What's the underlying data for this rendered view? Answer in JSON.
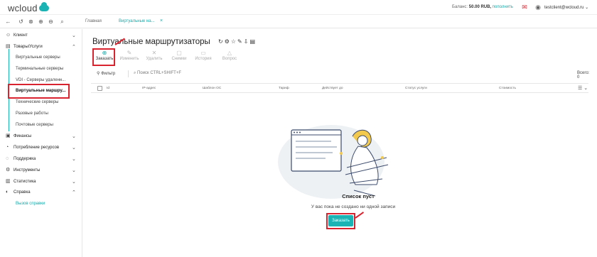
{
  "header": {
    "logo_text": "wcloud",
    "balance_label": "Баланс:",
    "balance_value": "50.00 RUB,",
    "topup_link": "пополнить",
    "user_email": "testclient@wcloud.ru"
  },
  "toolbar": {
    "tabs": [
      {
        "label": "Главная"
      },
      {
        "label": "Виртуальные на..."
      }
    ]
  },
  "sidebar": {
    "items": [
      {
        "label": "Клиент",
        "icon": "person-icon",
        "chevron": "⌄"
      },
      {
        "label": "Товары/Услуги",
        "icon": "cart-icon",
        "chevron": "⌃"
      },
      {
        "label": "Финансы",
        "icon": "wallet-icon",
        "chevron": "⌄"
      },
      {
        "label": "Потребление ресурсов",
        "icon": "gauge-icon",
        "chevron": "⌄"
      },
      {
        "label": "Поддержка",
        "icon": "chat-icon",
        "chevron": "⌄"
      },
      {
        "label": "Инструменты",
        "icon": "gear-icon",
        "chevron": "⌄"
      },
      {
        "label": "Статистика",
        "icon": "chart-icon",
        "chevron": "⌄"
      },
      {
        "label": "Справка",
        "icon": "help-icon",
        "chevron": "⌃"
      }
    ],
    "sub_items": [
      {
        "label": "Виртуальные серверы"
      },
      {
        "label": "Терминальные серверы"
      },
      {
        "label": "VDI - Серверы удаленн..."
      },
      {
        "label": "Виртуальные маршру..."
      },
      {
        "label": "Технические серверы"
      },
      {
        "label": "Разовые работы"
      },
      {
        "label": "Почтовые серверы"
      }
    ],
    "help_link": "Вызов справки"
  },
  "main": {
    "title": "Виртуальные маршрутизаторы",
    "actions": [
      {
        "label": "Заказать",
        "enabled": true
      },
      {
        "label": "Изменить",
        "enabled": false
      },
      {
        "label": "Удалить",
        "enabled": false
      },
      {
        "label": "Снимки",
        "enabled": false
      },
      {
        "label": "История",
        "enabled": false
      },
      {
        "label": "Вопрос",
        "enabled": false
      }
    ],
    "filter_label": "Фильтр",
    "search_placeholder": "Поиск CTRL+SHIFT+F",
    "total_label": "Всего: 0",
    "columns": [
      "Id",
      "IP-адрес",
      "Шаблон ОС",
      "Тариф",
      "Действует до",
      "Статус услуги",
      "Стоимость"
    ],
    "empty_title": "Список пуст",
    "empty_subtitle": "У вас пока не создано ни одной записи",
    "order_button": "Заказать"
  },
  "colors": {
    "accent": "#1bb3b3",
    "highlight": "#d9232e"
  }
}
